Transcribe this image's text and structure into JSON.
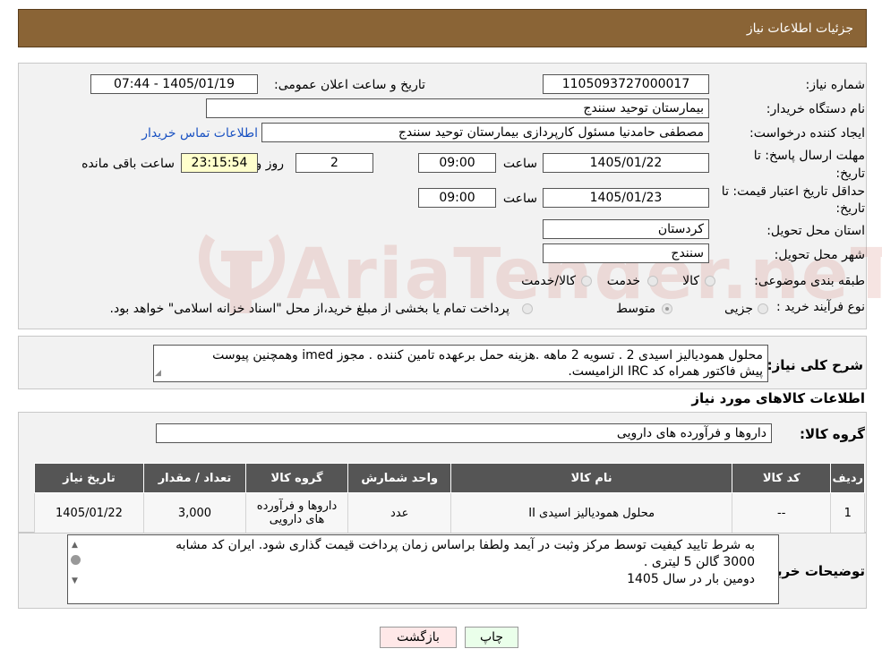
{
  "header": {
    "title": "جزئیات اطلاعات نیاز"
  },
  "form": {
    "need_number_label": "شماره نیاز:",
    "need_number": "1105093727000017",
    "announce_label": "تاریخ و ساعت اعلان عمومی:",
    "announce_value": "1405/01/19 - 07:44",
    "buyer_org_label": "نام دستگاه خریدار:",
    "buyer_org": "بیمارستان توحید سنندج",
    "creator_label": "ایجاد کننده درخواست:",
    "creator": "مصطفی حامدنیا مسئول کارپردازی بیمارستان توحید سنندج",
    "contact_link": "اطلاعات تماس خریدار",
    "deadline_label_1": "مهلت ارسال پاسخ: تا",
    "deadline_label_2": "تاریخ:",
    "deadline_date": "1405/01/22",
    "time_label": "ساعت",
    "deadline_time": "09:00",
    "days_value": "2",
    "days_label": "روز و",
    "remaining_time": "23:15:54",
    "remaining_label": "ساعت باقی مانده",
    "validity_label_1": "حداقل تاریخ اعتبار قیمت: تا",
    "validity_label_2": "تاریخ:",
    "validity_date": "1405/01/23",
    "validity_time": "09:00",
    "province_label": "استان محل تحویل:",
    "province": "کردستان",
    "city_label": "شهر محل تحویل:",
    "city": "سنندج",
    "category_label": "طبقه بندی موضوعی:",
    "category_options": [
      "کالا",
      "خدمت",
      "کالا/خدمت"
    ],
    "process_label": "نوع فرآیند خرید :",
    "process_options": [
      "جزیی",
      "متوسط"
    ],
    "process_note": "پرداخت تمام یا بخشی از مبلغ خرید،از محل \"اسناد خزانه اسلامی\" خواهد بود."
  },
  "description": {
    "label": "شرح کلی نیاز:",
    "line1": "محلول همودیالیز اسیدی  2 . تسویه 2 ماهه .هزینه حمل برعهده تامین کننده . مجوز imed وهمچنین پیوست",
    "line2": "پیش فاکتور همراه کد IRC  الزامیست."
  },
  "goods": {
    "section_title": "اطلاعات کالاهای مورد نیاز",
    "group_label": "گروه کالا:",
    "group_value": "داروها و فرآورده های دارویی",
    "columns": [
      "ردیف",
      "کد کالا",
      "نام کالا",
      "واحد شمارش",
      "گروه کالا",
      "تعداد / مقدار",
      "تاریخ نیاز"
    ],
    "rows": [
      {
        "row": "1",
        "code": "--",
        "name": "محلول همودیالیز اسیدی II",
        "unit": "عدد",
        "group": "داروها و فرآورده های دارویی",
        "qty": "3,000",
        "date": "1405/01/22"
      }
    ]
  },
  "buyer_notes": {
    "label": "توضیحات خریدار:",
    "line1": "به شرط تایید کیفیت توسط مرکز وثبت در آیمد ولطفا براساس زمان پرداخت  قیمت گذاری شود. ایران کد مشابه",
    "line2": "3000 گالن 5 لیتری .",
    "line3": "دومین بار در سال 1405"
  },
  "buttons": {
    "print": "چاپ",
    "back": "بازگشت"
  },
  "watermark": {
    "text": "AriaTender.neT"
  },
  "colors": {
    "header_bg": "#8a6436",
    "table_header_bg": "#555555",
    "remaining_bg": "#ffffcc",
    "print_bg": "#eaffea",
    "back_bg": "#ffe8e8"
  }
}
